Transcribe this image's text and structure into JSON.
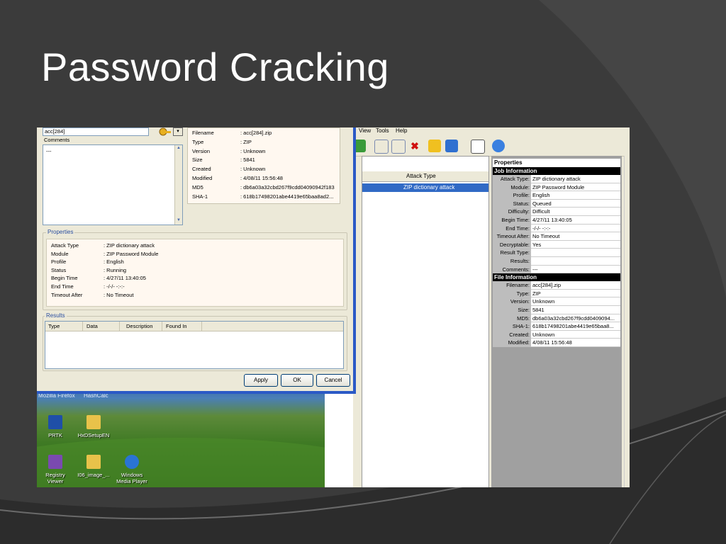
{
  "slide": {
    "title": "Password Cracking"
  },
  "dialog": {
    "filename_input": "acc[284]",
    "comments_label": "Comments",
    "comments_value": "---",
    "file_info": [
      {
        "key": "Filename",
        "value": ": acc[284].zip"
      },
      {
        "key": "Type",
        "value": ": ZIP"
      },
      {
        "key": "Version",
        "value": ": Unknown"
      },
      {
        "key": "Size",
        "value": ": 5841"
      },
      {
        "key": "Created",
        "value": ": Unknown"
      },
      {
        "key": "Modified",
        "value": ": 4/08/11 15:56:48"
      },
      {
        "key": "MD5",
        "value": ": db6a03a32cbd267f9cdd04090942f183"
      },
      {
        "key": "SHA-1",
        "value": ": 618b17498201abe4419e65baa8ad2..."
      }
    ],
    "properties_label": "Properties",
    "properties": [
      {
        "key": "Attack Type",
        "value": ": ZIP dictionary attack"
      },
      {
        "key": "Module",
        "value": ": ZIP Password Module"
      },
      {
        "key": "Profile",
        "value": ": English"
      },
      {
        "key": "Status",
        "value": ": Running"
      },
      {
        "key": "Begin Time",
        "value": ": 4/27/11 13:40:05"
      },
      {
        "key": "End Time",
        "value": ": -/-/- -:-:-"
      },
      {
        "key": "Timeout After",
        "value": ": No Timeout"
      }
    ],
    "results_label": "Results",
    "results_columns": [
      "Type",
      "Data",
      "Description",
      "Found In"
    ],
    "apply_label": "Apply",
    "ok_label": "OK",
    "cancel_label": "Cancel"
  },
  "desktop": {
    "taskbar": [
      "Mozilla Firefox",
      "HashCalc"
    ],
    "icons": [
      {
        "label": "PRTK"
      },
      {
        "label": "HxDSetupEN"
      },
      {
        "label": "Registry Viewer"
      },
      {
        "label": "I06_image_..."
      },
      {
        "label": "Windows Media Player"
      }
    ]
  },
  "app": {
    "menu": [
      "View",
      "Tools",
      "Help"
    ],
    "job_column": "Attack Type",
    "job_row": "ZIP dictionary attack",
    "properties_title": "Properties",
    "job_info_label": "Job Information",
    "job_info": [
      {
        "key": "Attack Type:",
        "value": "ZIP dictionary attack"
      },
      {
        "key": "Module:",
        "value": "ZIP Password Module"
      },
      {
        "key": "Profile:",
        "value": "English"
      },
      {
        "key": "Status:",
        "value": "Queued"
      },
      {
        "key": "Difficulty:",
        "value": "Difficult"
      },
      {
        "key": "Begin Time:",
        "value": "4/27/11 13:40:05"
      },
      {
        "key": "End Time:",
        "value": "-/-/- -:-:-"
      },
      {
        "key": "Timeout After:",
        "value": "No Timeout"
      },
      {
        "key": "Decryptable:",
        "value": "Yes"
      },
      {
        "key": "Result Type:",
        "value": ""
      },
      {
        "key": "Results:",
        "value": ""
      },
      {
        "key": "Comments:",
        "value": "---"
      }
    ],
    "file_info_label": "File Information",
    "file_info": [
      {
        "key": "Filename:",
        "value": "acc[284].zip"
      },
      {
        "key": "Type:",
        "value": "ZIP"
      },
      {
        "key": "Version:",
        "value": "Unknown"
      },
      {
        "key": "Size:",
        "value": "5841"
      },
      {
        "key": "MD5:",
        "value": "db6a03a32cbd267f9cdd0409094..."
      },
      {
        "key": "SHA-1:",
        "value": "618b17498201abe4419e65baa8..."
      },
      {
        "key": "Created:",
        "value": "Unknown"
      },
      {
        "key": "Modified:",
        "value": "4/08/11 15:56:48"
      }
    ]
  }
}
